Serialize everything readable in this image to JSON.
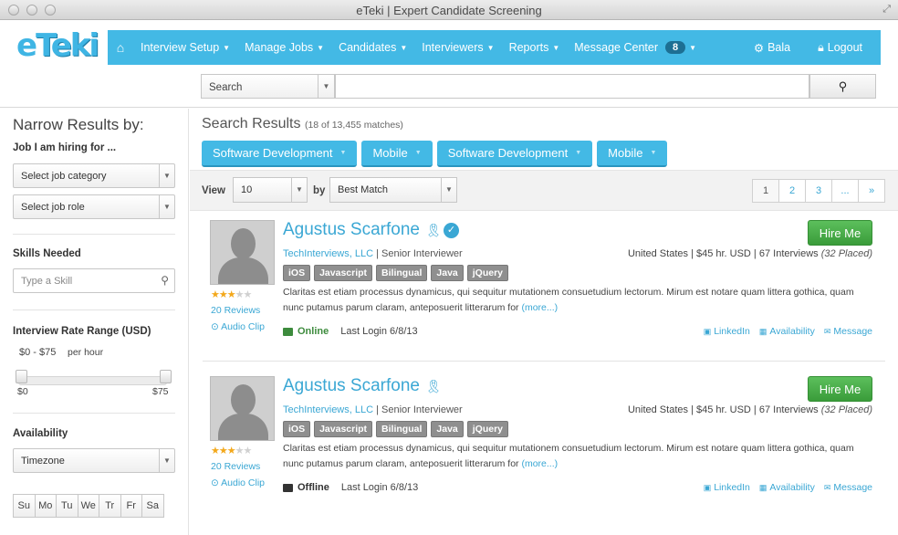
{
  "window": {
    "title": "eTeki | Expert Candidate Screening"
  },
  "logo": {
    "text_e": "e",
    "text_rest": "Teki"
  },
  "nav": {
    "items": [
      {
        "label": "Interview Setup"
      },
      {
        "label": "Manage Jobs"
      },
      {
        "label": "Candidates"
      },
      {
        "label": "Interviewers"
      },
      {
        "label": "Reports"
      },
      {
        "label": "Message Center"
      }
    ],
    "message_count": "8",
    "user": "Bala",
    "logout": "Logout"
  },
  "search": {
    "scope": "Search",
    "query": ""
  },
  "sidebar": {
    "title": "Narrow Results by:",
    "job_label": "Job I am hiring for ...",
    "job_category": "Select job category",
    "job_role": "Select job role",
    "skills_label": "Skills Needed",
    "skills_placeholder": "Type a Skill",
    "rate_label": "Interview Rate Range (USD)",
    "rate_range": "$0 - $75",
    "rate_unit": "per hour",
    "rate_min": "$0",
    "rate_max": "$75",
    "rate_low_fraction": 0,
    "rate_high_fraction": 1,
    "availability_label": "Availability",
    "timezone": "Timezone",
    "days": [
      "Su",
      "Mo",
      "Tu",
      "We",
      "Tr",
      "Fr",
      "Sa"
    ]
  },
  "results": {
    "title": "Search Results",
    "count": "(18 of 13,455 matches)",
    "filters": [
      "Software Development",
      "Mobile",
      "Software Development",
      "Mobile"
    ],
    "view_label": "View",
    "view_value": "10",
    "by_label": "by",
    "sort_value": "Best Match",
    "pages": [
      "1",
      "2",
      "3",
      "...",
      "»"
    ]
  },
  "candidates": [
    {
      "name": "Agustus Scarfone",
      "verified": true,
      "company": "TechInterviews, LLC",
      "role": "| Senior Interviewer",
      "meta": "United States | $45 hr. USD | 67 Interviews",
      "placed": "(32 Placed)",
      "skills": [
        "iOS",
        "Javascript",
        "Bilingual",
        "Java",
        "jQuery"
      ],
      "description": "Claritas est etiam processus dynamicus, qui sequitur mutationem consuetudium lectorum. Mirum est notare quam littera gothica, quam nunc putamus parum claram, anteposuerit litterarum for",
      "more": "(more...)",
      "rating": 3,
      "reviews": "20 Reviews",
      "audio": "Audio Clip",
      "status": "Online",
      "status_color": "#3d8b3d",
      "last_login": "Last Login 6/8/13",
      "hire": "Hire Me",
      "linkedin": "LinkedIn",
      "availability": "Availability",
      "message": "Message"
    },
    {
      "name": "Agustus Scarfone",
      "verified": false,
      "company": "TechInterviews, LLC",
      "role": "| Senior Interviewer",
      "meta": "United States | $45 hr. USD | 67 Interviews",
      "placed": "(32 Placed)",
      "skills": [
        "iOS",
        "Javascript",
        "Bilingual",
        "Java",
        "jQuery"
      ],
      "description": "Claritas est etiam processus dynamicus, qui sequitur mutationem consuetudium lectorum. Mirum est notare quam littera gothica, quam nunc putamus parum claram, anteposuerit litterarum for",
      "more": "(more...)",
      "rating": 3,
      "reviews": "20 Reviews",
      "audio": "Audio Clip",
      "status": "Offline",
      "status_color": "#333333",
      "last_login": "Last Login 6/8/13",
      "hire": "Hire Me",
      "linkedin": "LinkedIn",
      "availability": "Availability",
      "message": "Message"
    }
  ]
}
